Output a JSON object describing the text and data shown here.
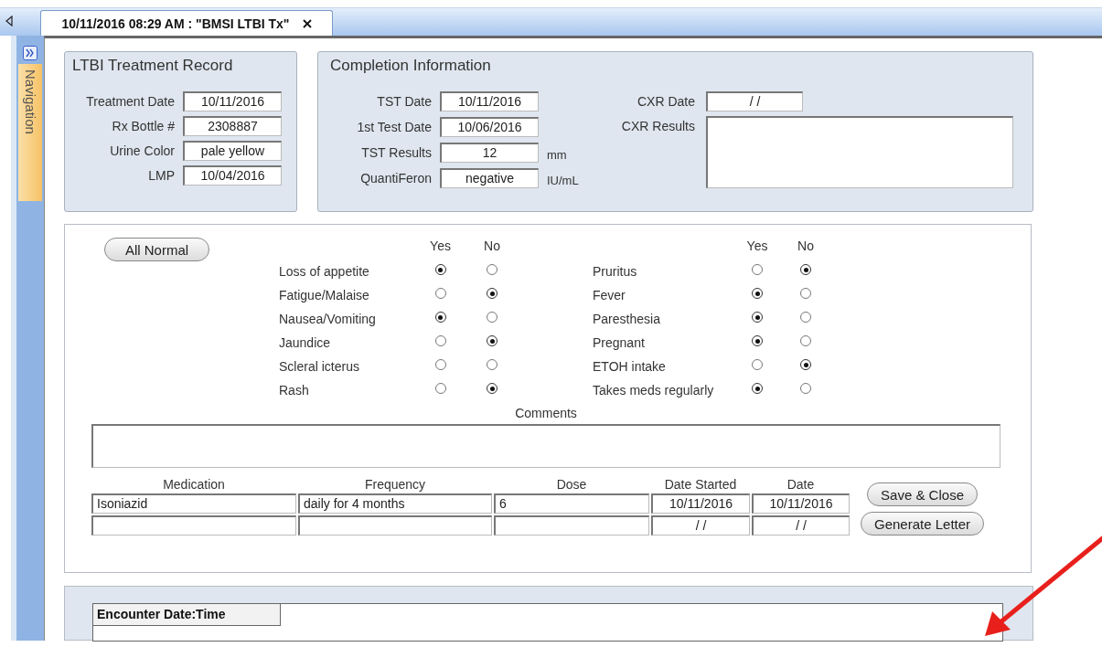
{
  "tab": {
    "title": "10/11/2016 08:29 AM : \"BMSI LTBI Tx\""
  },
  "navigation": {
    "label": "Navigation"
  },
  "treatment_record": {
    "title": "LTBI Treatment Record",
    "fields": [
      {
        "label": "Treatment Date",
        "value": "10/11/2016"
      },
      {
        "label": "Rx Bottle #",
        "value": "2308887"
      },
      {
        "label": "Urine Color",
        "value": "pale yellow"
      },
      {
        "label": "LMP",
        "value": "10/04/2016"
      }
    ]
  },
  "completion": {
    "title": "Completion Information",
    "fields": [
      {
        "label": "TST Date",
        "value": "10/11/2016"
      },
      {
        "label": "1st Test Date",
        "value": "10/06/2016"
      },
      {
        "label": "TST Results",
        "value": "12",
        "unit": "mm"
      },
      {
        "label": "QuantiFeron",
        "value": "negative",
        "unit": "IU/mL"
      }
    ],
    "cxr_date": {
      "label": "CXR Date",
      "value": "/ /"
    },
    "cxr_results": {
      "label": "CXR Results"
    }
  },
  "symptoms": {
    "all_normal_button": "All Normal",
    "columns": [
      {
        "yes_label": "Yes",
        "no_label": "No",
        "items": [
          {
            "label": "Loss of appetite",
            "yes": true,
            "no": false
          },
          {
            "label": "Fatigue/Malaise",
            "yes": false,
            "no": true
          },
          {
            "label": "Nausea/Vomiting",
            "yes": true,
            "no": false
          },
          {
            "label": "Jaundice",
            "yes": false,
            "no": true
          },
          {
            "label": "Scleral icterus",
            "yes": false,
            "no": false
          },
          {
            "label": "Rash",
            "yes": false,
            "no": true
          }
        ]
      },
      {
        "yes_label": "Yes",
        "no_label": "No",
        "items": [
          {
            "label": "Pruritus",
            "yes": false,
            "no": true
          },
          {
            "label": "Fever",
            "yes": true,
            "no": false
          },
          {
            "label": "Paresthesia",
            "yes": true,
            "no": false
          },
          {
            "label": "Pregnant",
            "yes": true,
            "no": false
          },
          {
            "label": "ETOH intake",
            "yes": false,
            "no": true
          },
          {
            "label": "Takes meds regularly",
            "yes": true,
            "no": false
          }
        ]
      }
    ]
  },
  "comments": {
    "label": "Comments"
  },
  "medications": {
    "columns": [
      "Medication",
      "Frequency",
      "Dose",
      "Date Started",
      "Date"
    ],
    "rows": [
      {
        "medication": "Isoniazid",
        "frequency": "daily for 4 months",
        "dose": "6",
        "date_started": "10/11/2016",
        "date": "10/11/2016"
      },
      {
        "date_started": "/ /",
        "date": "/ /"
      }
    ]
  },
  "buttons": [
    "Save & Close",
    "Generate Letter"
  ],
  "encounters": {
    "columns": [
      "Encounter Date:Time"
    ]
  }
}
